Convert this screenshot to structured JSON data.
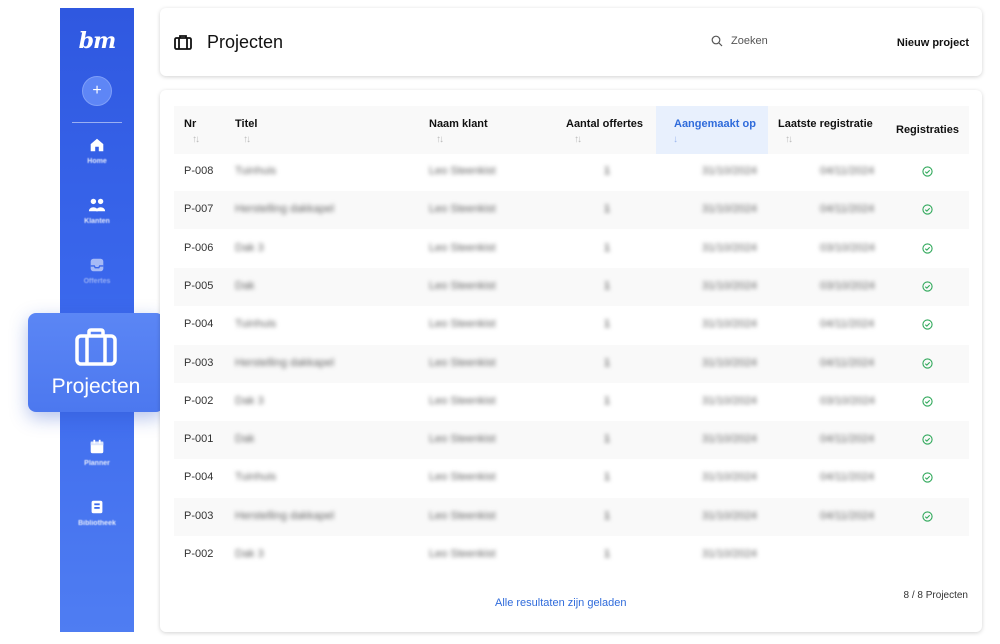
{
  "app": {
    "logo_text": "bm"
  },
  "sidebar": {
    "add_label": "+",
    "items": [
      {
        "label": "Home",
        "icon": "home-icon"
      },
      {
        "label": "Klanten",
        "icon": "users-icon"
      },
      {
        "label": "Offertes",
        "icon": "inbox-icon"
      },
      {
        "label": "Planner",
        "icon": "calendar-icon"
      },
      {
        "label": "Bibliotheek",
        "icon": "book-icon"
      }
    ],
    "active": {
      "label": "Projecten",
      "icon": "briefcase-icon"
    }
  },
  "header": {
    "title": "Projecten",
    "search_placeholder": "Zoeken",
    "new_project_label": "Nieuw project"
  },
  "table": {
    "columns": [
      "Nr",
      "Titel",
      "Naam klant",
      "Aantal offertes",
      "Aangemaakt op",
      "Laatste registratie",
      "Registraties"
    ],
    "sort_glyph": "↑↓",
    "active_sort_glyph": "↓",
    "rows": [
      {
        "nr": "P-008",
        "titel": "Tuinhuis",
        "klant": "Leo Steenkist",
        "offertes": "1",
        "aangemaakt": "31/10/2024",
        "laatste": "04/11/2024",
        "registratie": true
      },
      {
        "nr": "P-007",
        "titel": "Herstelling dakkapel",
        "klant": "Leo Steenkist",
        "offertes": "1",
        "aangemaakt": "31/10/2024",
        "laatste": "04/11/2024",
        "registratie": true
      },
      {
        "nr": "P-006",
        "titel": "Dak 3",
        "klant": "Leo Steenkist",
        "offertes": "1",
        "aangemaakt": "31/10/2024",
        "laatste": "03/10/2024",
        "registratie": true
      },
      {
        "nr": "P-005",
        "titel": "Dak",
        "klant": "Leo Steenkist",
        "offertes": "1",
        "aangemaakt": "31/10/2024",
        "laatste": "03/10/2024",
        "registratie": true
      },
      {
        "nr": "P-004",
        "titel": "Tuinhuis",
        "klant": "Leo Steenkist",
        "offertes": "1",
        "aangemaakt": "31/10/2024",
        "laatste": "04/11/2024",
        "registratie": true
      },
      {
        "nr": "P-003",
        "titel": "Herstelling dakkapel",
        "klant": "Leo Steenkist",
        "offertes": "1",
        "aangemaakt": "31/10/2024",
        "laatste": "04/11/2024",
        "registratie": true
      },
      {
        "nr": "P-002",
        "titel": "Dak 3",
        "klant": "Leo Steenkist",
        "offertes": "1",
        "aangemaakt": "31/10/2024",
        "laatste": "03/10/2024",
        "registratie": true
      },
      {
        "nr": "P-001",
        "titel": "Dak",
        "klant": "Leo Steenkist",
        "offertes": "1",
        "aangemaakt": "31/10/2024",
        "laatste": "04/11/2024",
        "registratie": true
      },
      {
        "nr": "P-004",
        "titel": "Tuinhuis",
        "klant": "Leo Steenkist",
        "offertes": "1",
        "aangemaakt": "31/10/2024",
        "laatste": "04/11/2024",
        "registratie": true
      },
      {
        "nr": "P-003",
        "titel": "Herstelling dakkapel",
        "klant": "Leo Steenkist",
        "offertes": "1",
        "aangemaakt": "31/10/2024",
        "laatste": "04/11/2024",
        "registratie": true
      },
      {
        "nr": "P-002",
        "titel": "Dak 3",
        "klant": "Leo Steenkist",
        "offertes": "1",
        "aangemaakt": "31/10/2024",
        "laatste": "",
        "registratie": false
      }
    ],
    "footer_message": "Alle resultaten zijn geladen",
    "count": "8 / 8 Projecten"
  },
  "colors": {
    "accent": "#2f6bdb",
    "sidebar": "#3a67ec",
    "check": "#2fa85a"
  }
}
